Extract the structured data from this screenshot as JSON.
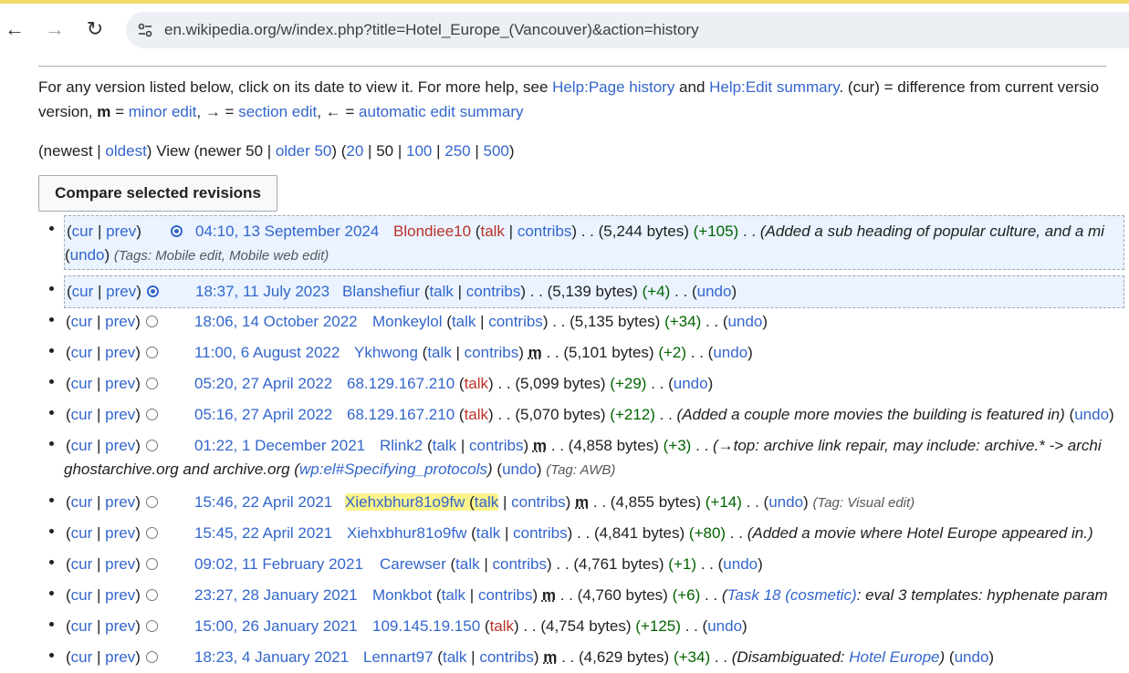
{
  "browser": {
    "url": "en.wikipedia.org/w/index.php?title=Hotel_Europe_(Vancouver)&action=history"
  },
  "help": {
    "line1_a": "For any version listed below, click on its date to view it. For more help, see ",
    "link_page_history": "Help:Page history",
    "and": " and ",
    "link_edit_summary": "Help:Edit summary",
    "line1_b": ". (cur) = difference from current versio",
    "line2_a": "version, ",
    "m": "m",
    "line2_b": " = ",
    "link_minor": "minor edit",
    "line2_c": ", → = ",
    "link_section": "section edit",
    "line2_d": ", ← = ",
    "link_auto": "automatic edit summary"
  },
  "nav": {
    "newest": "newest",
    "oldest": "oldest",
    "view": " View (newer 50 | ",
    "older": "older 50",
    "counts": [
      "20",
      "50",
      "100",
      "250",
      "500"
    ]
  },
  "compare_button": "Compare selected revisions",
  "history": [
    {
      "date": "04:10, 13 September 2024",
      "user": "Blondiee10",
      "user_red": true,
      "bytes": "(5,244 bytes)",
      "diff": "(+105)",
      "comment": "(Added a sub heading of popular culture, and a mi",
      "line2_undo": "undo",
      "line2_tags": "(Tags: Mobile edit, Mobile web edit)"
    },
    {
      "date": "18:37, 11 July 2023",
      "user": "Blanshefiur",
      "bytes": "(5,139 bytes)",
      "diff": "(+4)",
      "undo": "undo"
    },
    {
      "date": "18:06, 14 October 2022",
      "user": "Monkeylol",
      "bytes": "(5,135 bytes)",
      "diff": "(+34)",
      "undo": "undo"
    },
    {
      "date": "11:00, 6 August 2022",
      "user": "Ykhwong",
      "bytes": "(5,101 bytes)",
      "diff": "(+2)",
      "undo": "undo",
      "minor": "m"
    },
    {
      "date": "05:20, 27 April 2022",
      "user": "68.129.167.210",
      "bytes": "(5,099 bytes)",
      "diff": "(+29)",
      "undo": "undo"
    },
    {
      "date": "05:16, 27 April 2022",
      "user": "68.129.167.210",
      "bytes": "(5,070 bytes)",
      "diff": "(+212)",
      "comment": "(Added a couple more movies the building is featured in)",
      "undo": "undo"
    },
    {
      "date": "01:22, 1 December 2021",
      "user": "Rlink2",
      "bytes": "(4,858 bytes)",
      "diff": "(+3)",
      "minor": "m",
      "comment_a": "(→top:",
      "comment_b": " archive link repair, may include: archive.* -> archi",
      "line2_a": "ghostarchive.org and archive.org (",
      "line2_link": "wp:el#Specifying_protocols",
      "line2_b": ")",
      "line2_undo": "undo",
      "line2_tags": "(Tag: AWB)"
    },
    {
      "date": "15:46, 22 April 2021",
      "user": "Xiehxbhur81o9fw",
      "bytes": "(4,855 bytes)",
      "diff": "(+14)",
      "minor": "m",
      "undo": "undo",
      "tags": "(Tag: Visual edit)",
      "highlight": true
    },
    {
      "date": "15:45, 22 April 2021",
      "user": "Xiehxbhur81o9fw",
      "bytes": "(4,841 bytes)",
      "diff": "(+80)",
      "comment": "(Added a movie where Hotel Europe appeared in.)"
    },
    {
      "date": "09:02, 11 February 2021",
      "user": "Carewser",
      "bytes": "(4,761 bytes)",
      "diff": "(+1)",
      "undo": "undo"
    },
    {
      "date": "23:27, 28 January 2021",
      "user": "Monkbot",
      "bytes": "(4,760 bytes)",
      "diff": "(+6)",
      "minor": "m",
      "comment_link": "Task 18 (cosmetic)",
      "comment_b": ": eval 3 templates: hyphenate param"
    },
    {
      "date": "15:00, 26 January 2021",
      "user": "109.145.19.150",
      "bytes": "(4,754 bytes)",
      "diff": "(+125)",
      "undo": "undo"
    },
    {
      "date": "18:23, 4 January 2021",
      "user": "Lennart97",
      "bytes": "(4,629 bytes)",
      "diff": "(+34)",
      "minor": "m",
      "comment_c": "(Disambiguated: ",
      "comment_link2": "Hotel Europe",
      "comment_d": ")",
      "undo": "undo"
    }
  ],
  "labels": {
    "cur": "cur",
    "prev": "prev",
    "talk": "talk",
    "contribs": "contribs"
  }
}
